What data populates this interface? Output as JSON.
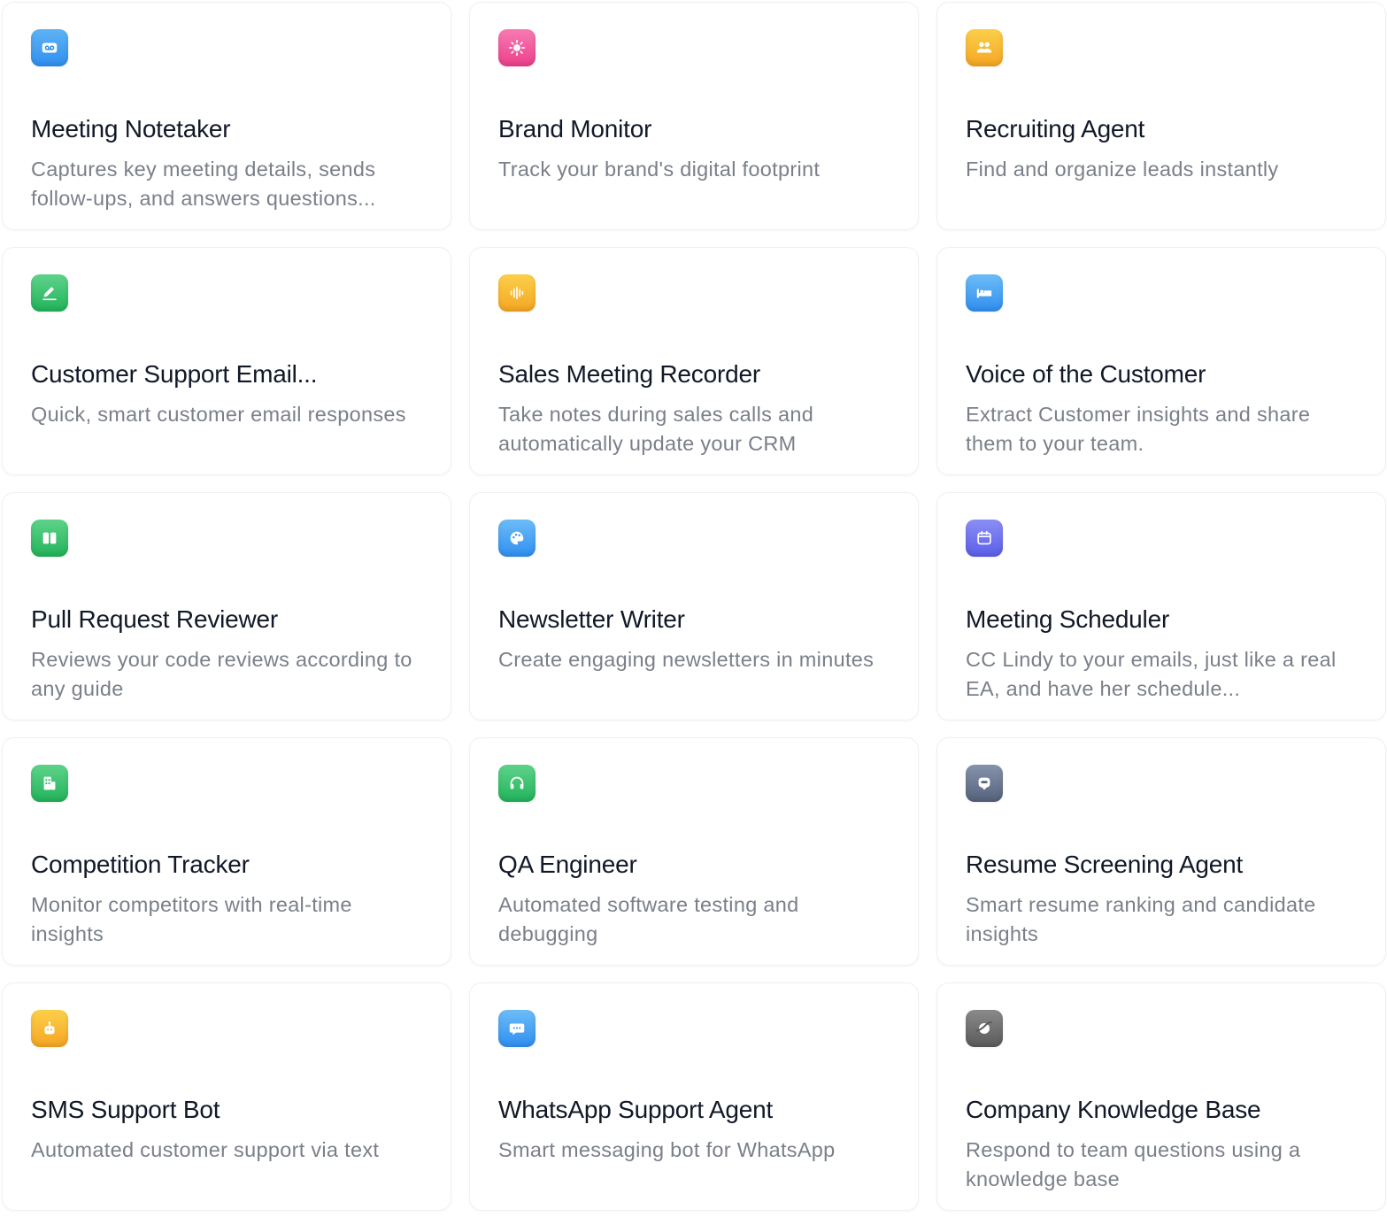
{
  "cards": [
    {
      "title": "Meeting Notetaker",
      "description": "Captures key meeting details, sends follow-ups, and answers questions...",
      "icon": "voicemail-icon",
      "color_top": "#5fb3f5",
      "color_bottom": "#2f8ff0"
    },
    {
      "title": "Brand Monitor",
      "description": "Track your brand's digital footprint",
      "icon": "sparkle-icon",
      "color_top": "#f77bb3",
      "color_bottom": "#ec3f8a"
    },
    {
      "title": "Recruiting Agent",
      "description": "Find and organize leads instantly",
      "icon": "people-icon",
      "color_top": "#fcd04a",
      "color_bottom": "#f5a623"
    },
    {
      "title": "Customer Support Email...",
      "description": "Quick, smart customer email responses",
      "icon": "pencil-icon",
      "color_top": "#5ed38a",
      "color_bottom": "#22b35a"
    },
    {
      "title": "Sales Meeting Recorder",
      "description": "Take notes during sales calls and automatically update your CRM",
      "icon": "waveform-icon",
      "color_top": "#fcd04a",
      "color_bottom": "#f5a623"
    },
    {
      "title": "Voice of the Customer",
      "description": "Extract Customer insights and share them to your team.",
      "icon": "bed-icon",
      "color_top": "#6cbcf7",
      "color_bottom": "#2f8ff0"
    },
    {
      "title": "Pull Request Reviewer",
      "description": "Reviews your code reviews according to any guide",
      "icon": "book-icon",
      "color_top": "#5ed38a",
      "color_bottom": "#22b35a"
    },
    {
      "title": "Newsletter Writer",
      "description": "Create engaging newsletters in minutes",
      "icon": "palette-icon",
      "color_top": "#6cbcf7",
      "color_bottom": "#2f8ff0"
    },
    {
      "title": "Meeting Scheduler",
      "description": "CC Lindy to your emails, just like a real EA, and have her schedule...",
      "icon": "calendar-icon",
      "color_top": "#8b8ef5",
      "color_bottom": "#5b5ee8"
    },
    {
      "title": "Competition Tracker",
      "description": "Monitor competitors with real-time insights",
      "icon": "building-icon",
      "color_top": "#5ed38a",
      "color_bottom": "#22b35a"
    },
    {
      "title": "QA Engineer",
      "description": "Automated software testing and debugging",
      "icon": "headphones-icon",
      "color_top": "#5ed38a",
      "color_bottom": "#22b35a"
    },
    {
      "title": "Resume Screening Agent",
      "description": "Smart resume ranking and candidate insights",
      "icon": "robot-icon",
      "color_top": "#8693ad",
      "color_bottom": "#56627c"
    },
    {
      "title": "SMS Support Bot",
      "description": "Automated customer support via text",
      "icon": "bot-icon",
      "color_top": "#fcd04a",
      "color_bottom": "#f5a623"
    },
    {
      "title": "WhatsApp Support Agent",
      "description": "Smart messaging bot for WhatsApp",
      "icon": "chat-icon",
      "color_top": "#6cbcf7",
      "color_bottom": "#2f8ff0"
    },
    {
      "title": "Company Knowledge Base",
      "description": "Respond to team questions using a knowledge base",
      "icon": "planet-icon",
      "color_top": "#8a8a8a",
      "color_bottom": "#5a5a5a"
    }
  ]
}
